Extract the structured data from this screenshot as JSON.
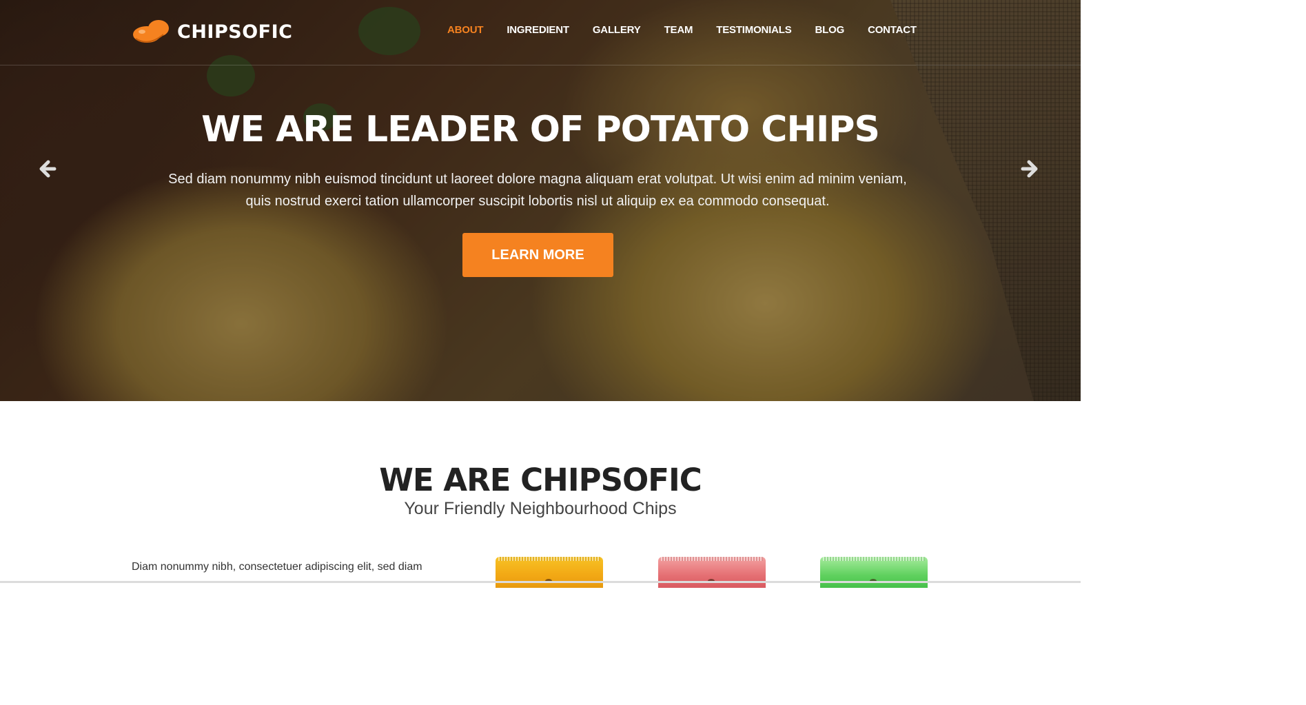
{
  "brand": {
    "name": "CHIPSOFIC",
    "logo_icon": "chip-logo-icon",
    "accent": "#f58220"
  },
  "nav": {
    "items": [
      {
        "label": "ABOUT",
        "active": true
      },
      {
        "label": "INGREDIENT",
        "active": false
      },
      {
        "label": "GALLERY",
        "active": false
      },
      {
        "label": "TEAM",
        "active": false
      },
      {
        "label": "TESTIMONIALS",
        "active": false
      },
      {
        "label": "BLOG",
        "active": false
      },
      {
        "label": "CONTACT",
        "active": false
      }
    ]
  },
  "hero": {
    "title": "WE ARE LEADER OF POTATO CHIPS",
    "text": "Sed diam nonummy nibh euismod tincidunt ut laoreet dolore magna aliquam erat volutpat. Ut wisi enim ad minim veniam, quis nostrud exerci tation ullamcorper suscipit lobortis nisl ut aliquip ex ea commodo consequat.",
    "button_label": "LEARN MORE",
    "prev_icon": "arrow-left-icon",
    "next_icon": "arrow-right-icon"
  },
  "about": {
    "title": "WE ARE CHIPSOFIC",
    "subtitle": "Your Friendly Neighbourhood Chips",
    "text": "Diam nonummy nibh, consectetuer adipiscing elit, sed diam",
    "bag_colors": [
      "#f2a814",
      "#e56f73",
      "#5fd15e"
    ]
  }
}
